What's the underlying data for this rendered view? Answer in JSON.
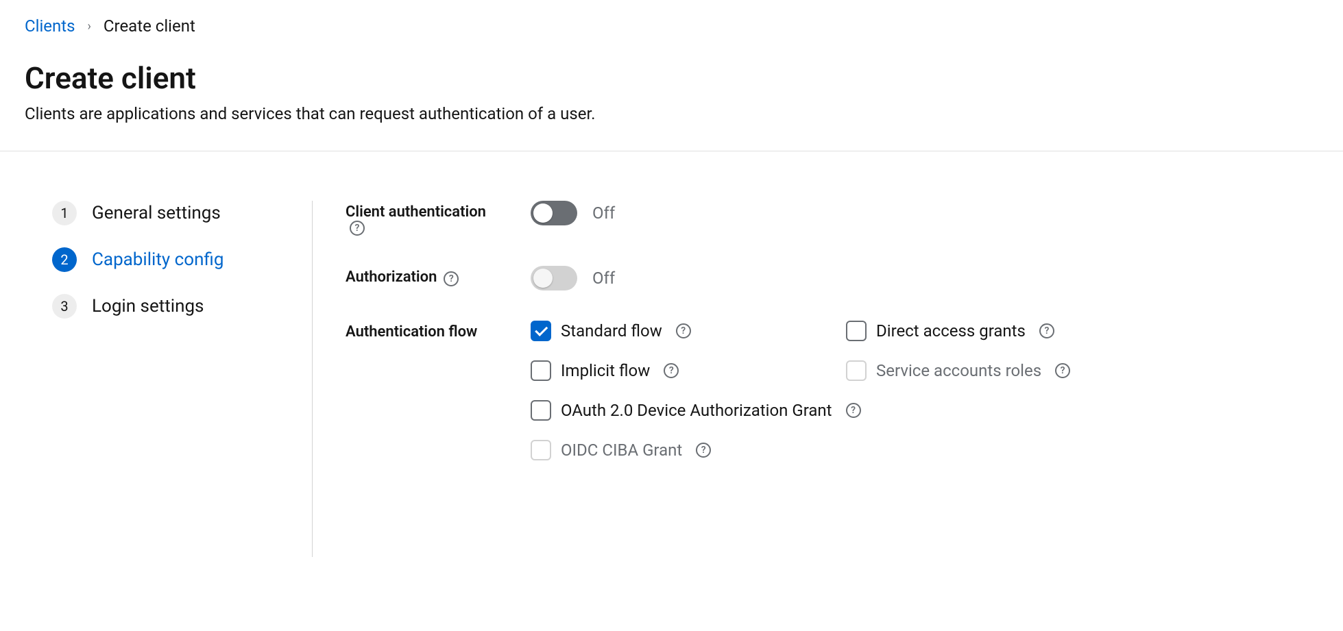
{
  "breadcrumb": {
    "root": "Clients",
    "current": "Create client"
  },
  "header": {
    "title": "Create client",
    "subtitle": "Clients are applications and services that can request authentication of a user."
  },
  "steps": [
    {
      "num": "1",
      "label": "General settings"
    },
    {
      "num": "2",
      "label": "Capability config"
    },
    {
      "num": "3",
      "label": "Login settings"
    }
  ],
  "form": {
    "client_auth": {
      "label": "Client authentication",
      "state": "Off"
    },
    "authorization": {
      "label": "Authorization",
      "state": "Off"
    },
    "auth_flow": {
      "label": "Authentication flow",
      "options": {
        "standard": "Standard flow",
        "direct": "Direct access grants",
        "implicit": "Implicit flow",
        "service": "Service accounts roles",
        "device": "OAuth 2.0 Device Authorization Grant",
        "ciba": "OIDC CIBA Grant"
      }
    }
  }
}
